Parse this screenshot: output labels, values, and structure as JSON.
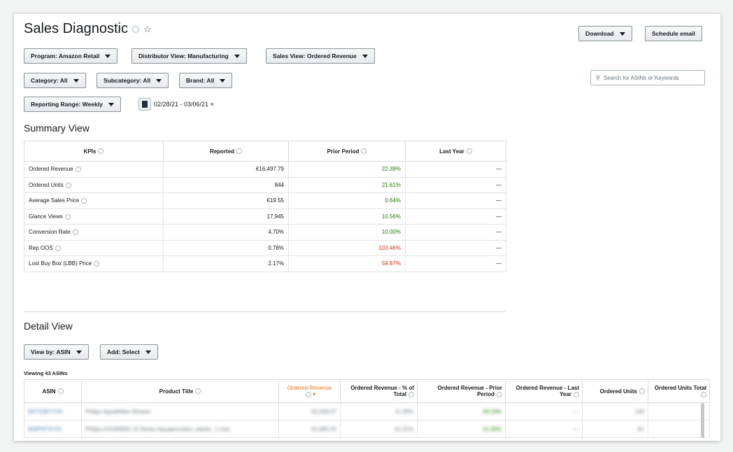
{
  "header": {
    "title": "Sales Diagnostic"
  },
  "top_buttons": {
    "download": "Download",
    "schedule": "Schedule email"
  },
  "filters": {
    "program": "Program: Amazon Retail",
    "distributor": "Distributor View: Manufacturing",
    "sales_view": "Sales View: Ordered Revenue",
    "category": "Category: All",
    "subcategory": "Subcategory: All",
    "brand": "Brand: All",
    "reporting_range": "Reporting Range: Weekly",
    "date_range": "02/28/21 - 03/06/21 ×"
  },
  "search": {
    "placeholder": "Search for ASINs or Keywords"
  },
  "summary": {
    "heading": "Summary View",
    "columns": [
      "KPIs",
      "Reported",
      "Prior Period",
      "Last Year"
    ],
    "rows": [
      {
        "kpi": "Ordered Revenue",
        "reported": "€16,497.79",
        "prior": "22.39%",
        "last": "—"
      },
      {
        "kpi": "Ordered Units",
        "reported": "844",
        "prior": "21.61%",
        "last": "—"
      },
      {
        "kpi": "Average Sales Price",
        "reported": "€19.55",
        "prior": "0.64%",
        "last": "—"
      },
      {
        "kpi": "Glance Views",
        "reported": "17,945",
        "prior": "10.56%",
        "last": "—"
      },
      {
        "kpi": "Conversion Rate",
        "reported": "4.70%",
        "prior": "10.00%",
        "last": "—"
      },
      {
        "kpi": "Rep OOS",
        "reported": "0.78%",
        "prior": "103.46%",
        "last": "—"
      },
      {
        "kpi": "Lost Buy Box (LBB) Price",
        "reported": "2.17%",
        "prior": "59.87%",
        "last": "—"
      }
    ]
  },
  "detail": {
    "heading": "Detail View",
    "view_by": "View by: ASIN",
    "add": "Add: Select",
    "viewing": "Viewing 43 ASINs",
    "columns": [
      "ASIN",
      "Product Title",
      "Ordered Revenue",
      "Ordered Revenue - % of Total",
      "Ordered Revenue - Prior Period",
      "Ordered Revenue - Last Year",
      "Ordered Units",
      "Ordered Units Total"
    ],
    "rows": [
      {
        "asin": "B07X2B7YXK",
        "title": "Philips AquaWake Shower",
        "rev": "€2,009.07",
        "pct": "11.28%",
        "prior": "28.23%",
        "last": "—",
        "units": "106"
      },
      {
        "asin": "B08P6T4Y3C",
        "title": "Philips AX5408/60 15 Series Aquaprecision, plastic, 1 Liter",
        "rev": "€1,683.30",
        "pct": "10.21%",
        "prior": "15.30%",
        "last": "—",
        "units": "81"
      }
    ]
  },
  "colors": {
    "positive": "#1d8102",
    "negative": "#d13212",
    "sort_highlight": "#ec7211"
  }
}
